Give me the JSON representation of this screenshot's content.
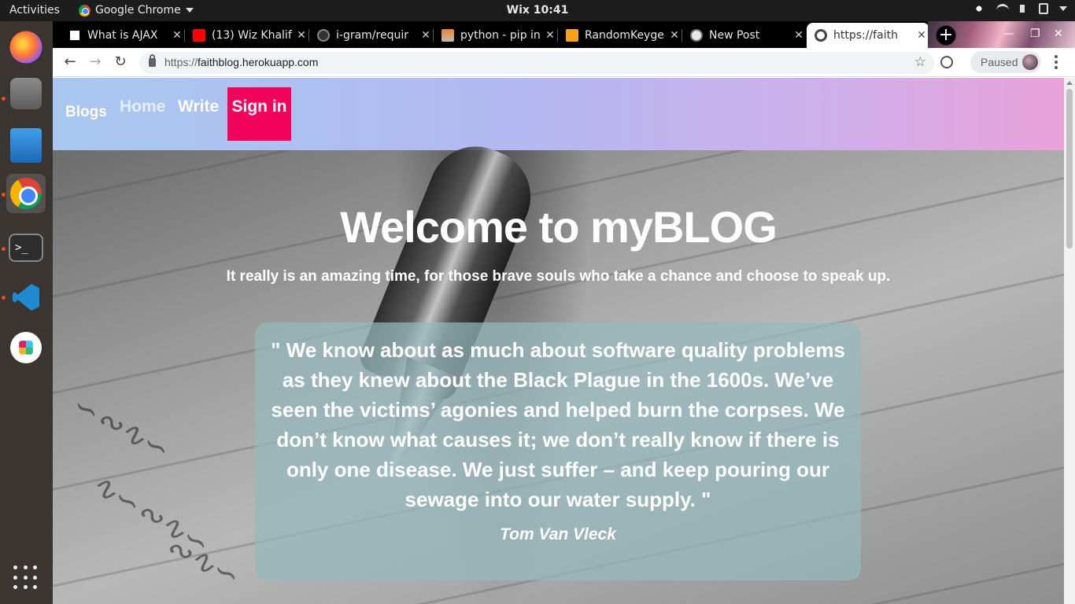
{
  "os": {
    "activities": "Activities",
    "app_name": "Google Chrome",
    "clock": "Wix 10:41"
  },
  "browser": {
    "tabs": [
      {
        "title": "What is AJAX",
        "icon": "ajax-favicon"
      },
      {
        "title": "(13) Wiz Khalif",
        "icon": "youtube-favicon"
      },
      {
        "title": "i-gram/requir",
        "icon": "github-favicon"
      },
      {
        "title": "python - pip in",
        "icon": "stackoverflow-favicon"
      },
      {
        "title": "RandomKeyge",
        "icon": "randomkeygen-favicon"
      },
      {
        "title": "New Post",
        "icon": "globe-favicon"
      },
      {
        "title": "https://faith",
        "icon": "globe-favicon",
        "active": true
      }
    ],
    "new_tab_label": "+",
    "url_scheme": "https://",
    "url_host": "faithblog.herokuapp.com",
    "profile_status": "Paused"
  },
  "site": {
    "brand": "Blogs",
    "nav": {
      "home": "Home",
      "write": "Write",
      "signin": "Sign in"
    },
    "hero": {
      "title": "Welcome to myBLOG",
      "subtitle": "It really is an amazing time, for those brave souls who take a chance and choose to speak up."
    },
    "quote": {
      "text": "\" We know about as much about software quality problems as they knew about the Black Plague in the 1600s. We’ve seen the victims’ agonies and helped burn the corpses. We don’t know what causes it; we don’t really know if there is only one disease. We just suffer – and keep pouring our sewage into our water supply. \"",
      "author": "Tom Van Vleck"
    }
  },
  "colors": {
    "signin_bg": "#f2045b",
    "navbar_gradient_start": "#a8c8f0",
    "navbar_gradient_end": "#eaa2d9"
  }
}
